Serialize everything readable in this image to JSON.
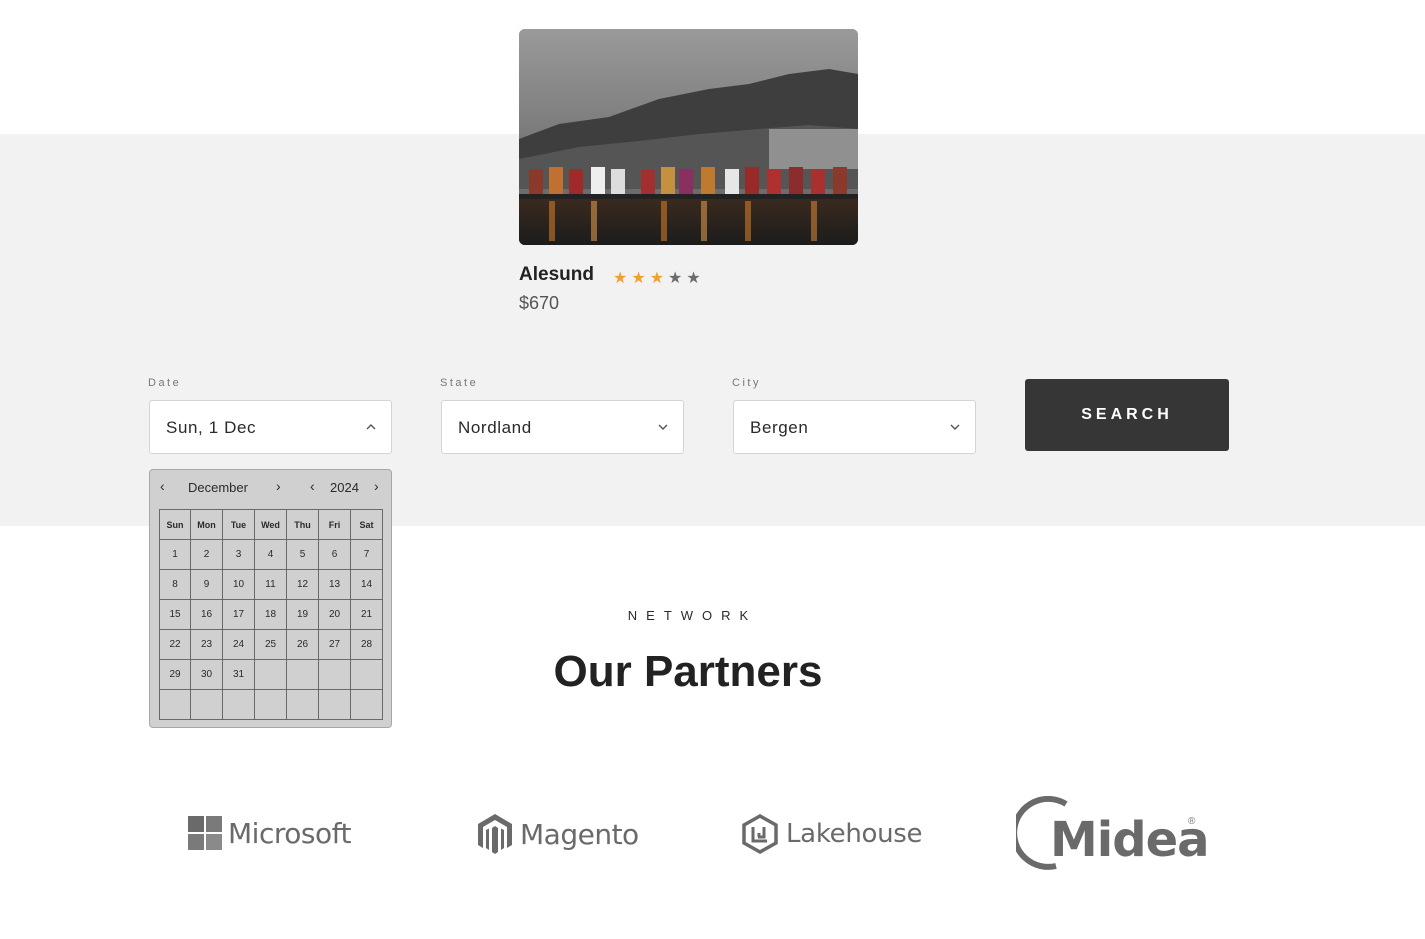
{
  "card": {
    "title": "Alesund",
    "price": "$670",
    "rating": 3,
    "rating_max": 5
  },
  "search_form": {
    "date": {
      "label": "Date",
      "value": "Sun, 1 Dec"
    },
    "state": {
      "label": "State",
      "value": "Nordland"
    },
    "city": {
      "label": "City",
      "value": "Bergen"
    },
    "search_button": "SEARCH"
  },
  "calendar": {
    "month": "December",
    "year": "2024",
    "weekdays": [
      "Sun",
      "Mon",
      "Tue",
      "Wed",
      "Thu",
      "Fri",
      "Sat"
    ],
    "weeks": [
      [
        "1",
        "2",
        "3",
        "4",
        "5",
        "6",
        "7"
      ],
      [
        "8",
        "9",
        "10",
        "11",
        "12",
        "13",
        "14"
      ],
      [
        "15",
        "16",
        "17",
        "18",
        "19",
        "20",
        "21"
      ],
      [
        "22",
        "23",
        "24",
        "25",
        "26",
        "27",
        "28"
      ],
      [
        "29",
        "30",
        "31",
        "",
        "",
        "",
        ""
      ],
      [
        "",
        "",
        "",
        "",
        "",
        "",
        ""
      ]
    ]
  },
  "partners": {
    "eyebrow": "NETWORK",
    "title": "Our Partners",
    "logos": [
      "Microsoft",
      "Magento",
      "Lakehouse",
      "Midea"
    ]
  },
  "colors": {
    "band": "#f2f2f2",
    "button": "#363636",
    "star_on": "#f0a02c",
    "star_off": "#6c6c6c"
  }
}
